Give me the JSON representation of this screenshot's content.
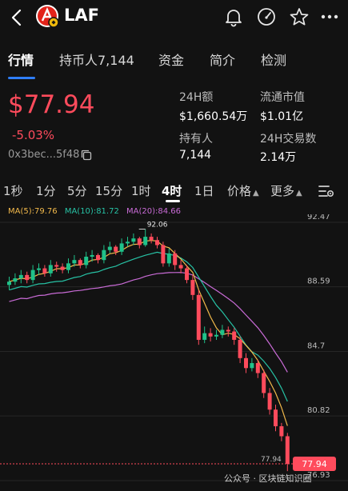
{
  "header": {
    "coin_name": "LAF",
    "icons": [
      "back-icon",
      "bell-icon",
      "gauge-icon",
      "star-icon",
      "more-icon"
    ]
  },
  "tabs": [
    "行情",
    "持币人7,144",
    "资金",
    "简介",
    "检测"
  ],
  "token": {
    "price": "$77.94",
    "change": "-5.03%",
    "address": "0x3bec...5f48"
  },
  "stats": {
    "vol24h_label": "24H额",
    "vol24h_value": "$1,660.54万",
    "mcap_label": "流通市值",
    "mcap_value": "$1.01亿",
    "holders_label": "持有人",
    "holders_value": "7,144",
    "tx24h_label": "24H交易数",
    "tx24h_value": "2.14万"
  },
  "intervals": {
    "items": [
      "1秒",
      "1分",
      "5分",
      "15分",
      "1时",
      "4时",
      "1日"
    ],
    "active": "4时",
    "price_label": "价格",
    "more_label": "更多"
  },
  "ma": {
    "ma5": "MA(5):79.76",
    "ma10": "MA(10):81.72",
    "ma20": "MA(20):84.66"
  },
  "colors": {
    "up": "#1fc28a",
    "down": "#ff4b5c",
    "ma5": "#f2b94b",
    "ma10": "#27c2a5",
    "ma20": "#c96bd6",
    "accent": "#2f7ef7"
  },
  "chart_data": {
    "type": "candlestick",
    "y_ticks": [
      "92.47",
      "88.59",
      "84.7",
      "80.82",
      "76.93"
    ],
    "ylim": [
      76.93,
      92.47
    ],
    "high_label": "92.06",
    "last_price_label": "77.94",
    "last_price_tag": "77.94",
    "series": {
      "open": [
        88.7,
        88.9,
        89.1,
        89.3,
        89.0,
        89.6,
        89.7,
        89.4,
        89.9,
        89.8,
        89.6,
        90.0,
        90.2,
        89.9,
        90.4,
        90.5,
        90.2,
        90.8,
        91.0,
        90.7,
        91.2,
        91.3,
        91.5,
        91.1,
        91.6,
        91.4,
        91.1,
        90.0,
        90.6,
        89.9,
        89.7,
        89.0,
        88.1,
        85.4,
        85.8,
        85.6,
        85.7,
        86.0,
        85.9,
        85.4,
        84.3,
        83.7,
        84.0,
        83.4,
        82.2,
        81.2,
        80.2,
        79.6
      ],
      "close": [
        88.9,
        89.1,
        89.3,
        89.0,
        89.6,
        89.7,
        89.4,
        89.9,
        89.8,
        89.6,
        90.0,
        90.2,
        89.9,
        90.4,
        90.5,
        90.2,
        90.8,
        91.0,
        90.7,
        91.2,
        91.3,
        91.5,
        91.1,
        91.6,
        91.4,
        91.1,
        90.0,
        90.6,
        89.9,
        89.7,
        89.0,
        88.1,
        85.4,
        85.8,
        85.6,
        85.7,
        86.0,
        85.9,
        85.4,
        84.3,
        83.7,
        84.0,
        83.4,
        82.2,
        81.2,
        80.2,
        79.6,
        77.94
      ],
      "high": [
        89.2,
        89.4,
        89.6,
        89.5,
        89.9,
        90.0,
        89.9,
        90.2,
        90.1,
        90.0,
        90.3,
        90.5,
        90.3,
        90.7,
        90.8,
        90.6,
        91.1,
        91.3,
        91.1,
        91.5,
        91.6,
        91.8,
        91.6,
        92.06,
        91.8,
        91.6,
        91.3,
        90.9,
        90.8,
        90.2,
        89.9,
        89.3,
        88.4,
        86.2,
        86.1,
        86.0,
        86.3,
        86.2,
        86.1,
        85.6,
        84.6,
        84.3,
        84.2,
        83.6,
        82.5,
        81.5,
        80.4,
        79.8
      ],
      "low": [
        88.4,
        88.7,
        88.8,
        88.8,
        88.8,
        89.3,
        89.2,
        89.2,
        89.5,
        89.4,
        89.4,
        89.8,
        89.7,
        89.7,
        90.1,
        90.0,
        90.0,
        90.6,
        90.5,
        90.5,
        91.0,
        91.1,
        90.9,
        91.0,
        91.2,
        90.9,
        89.8,
        89.8,
        89.6,
        89.4,
        88.8,
        87.8,
        85.1,
        85.2,
        85.3,
        85.4,
        85.5,
        85.6,
        85.1,
        84.0,
        83.4,
        83.5,
        83.1,
        81.9,
        80.9,
        79.9,
        79.3,
        77.5
      ]
    }
  },
  "watermark": "公众号 · 区块链知识圈"
}
